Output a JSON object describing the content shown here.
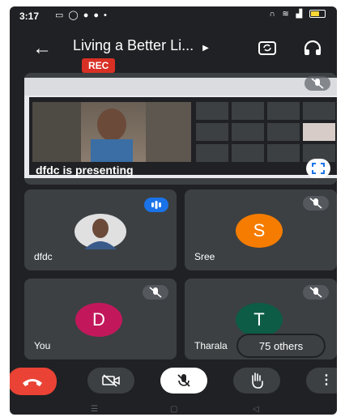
{
  "status_bar": {
    "time": "3:17",
    "left_icons": [
      "chat-icon",
      "whatsapp-icon",
      "location-icon",
      "message-icon",
      "dot-icon"
    ],
    "right_icons": [
      "headset-icon",
      "wifi-icon",
      "signal-icon",
      "battery-icon"
    ]
  },
  "header": {
    "title": "Living a Better Li...",
    "rec_label": "REC"
  },
  "presentation": {
    "presenter_label": "dfdc is presenting"
  },
  "tiles": [
    {
      "name": "dfdc",
      "initial": "",
      "avatar_color": "#e0e0e0",
      "status": "speaking"
    },
    {
      "name": "Sree",
      "initial": "S",
      "avatar_color": "#f57c00",
      "status": "muted"
    },
    {
      "name": "You",
      "initial": "D",
      "avatar_color": "#c2185b",
      "status": "muted"
    },
    {
      "name": "Tharala",
      "initial": "T",
      "avatar_color": "#0d5c46",
      "status": "muted"
    }
  ],
  "others": {
    "label": "75 others"
  },
  "colors": {
    "background": "#202124",
    "tile": "#3c4043",
    "rec": "#d93025",
    "end_call": "#ea4335",
    "speaking": "#1a73e8"
  }
}
